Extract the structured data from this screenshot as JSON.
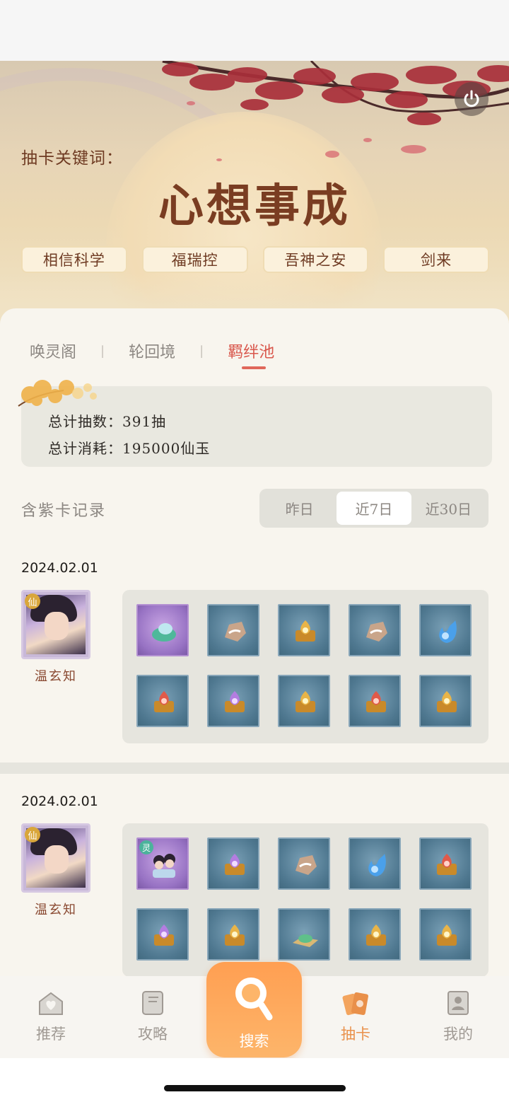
{
  "hero": {
    "keyword_label": "抽卡关键词：",
    "keyword_title": "心想事成",
    "tags": [
      "相信科学",
      "福瑞控",
      "吾神之安",
      "剑来"
    ]
  },
  "tabs": [
    {
      "label": "唤灵阁",
      "active": false
    },
    {
      "label": "轮回境",
      "active": false
    },
    {
      "label": "羁绊池",
      "active": true
    }
  ],
  "tab_separator": "|",
  "summary": {
    "total_draws": "总计抽数：391抽",
    "total_cost": "总计消耗：195000仙玉"
  },
  "records": {
    "label": "含紫卡记录",
    "filters": [
      {
        "label": "昨日",
        "active": false
      },
      {
        "label": "近7日",
        "active": true
      },
      {
        "label": "近30日",
        "active": false
      }
    ],
    "entries": [
      {
        "date": "2024.02.01",
        "character": {
          "name": "温玄知",
          "badge": "仙"
        },
        "items": [
          {
            "kind": "fairy-pet",
            "rarity": "purple",
            "icon": "jade-creature-icon",
            "color": "#4fb89a"
          },
          {
            "kind": "stone",
            "rarity": "blue",
            "icon": "stone-icon",
            "color": "#c9a58a"
          },
          {
            "kind": "gold-chest",
            "rarity": "blue",
            "icon": "gold-chest-icon",
            "color": "#e8b448"
          },
          {
            "kind": "stone",
            "rarity": "blue",
            "icon": "stone-icon",
            "color": "#c9a58a"
          },
          {
            "kind": "blue-flame",
            "rarity": "blue",
            "icon": "blue-flame-icon",
            "color": "#4aa0ea"
          },
          {
            "kind": "red-chest",
            "rarity": "blue",
            "icon": "red-chest-icon",
            "color": "#e05a4a"
          },
          {
            "kind": "purple-chest",
            "rarity": "blue",
            "icon": "purple-chest-icon",
            "color": "#b37de0"
          },
          {
            "kind": "gold-chest",
            "rarity": "blue",
            "icon": "gold-chest-icon",
            "color": "#e8b448"
          },
          {
            "kind": "red-chest",
            "rarity": "blue",
            "icon": "red-chest-icon",
            "color": "#e05a4a"
          },
          {
            "kind": "gold-chest",
            "rarity": "blue",
            "icon": "gold-chest-icon",
            "color": "#e8b448"
          }
        ]
      },
      {
        "date": "2024.02.01",
        "character": {
          "name": "温玄知",
          "badge": "仙"
        },
        "items": [
          {
            "kind": "spirit-card",
            "rarity": "purple",
            "icon": "spirit-card-icon",
            "color": "#6a5a8a",
            "badge": "灵"
          },
          {
            "kind": "purple-chest",
            "rarity": "blue",
            "icon": "purple-chest-icon",
            "color": "#b37de0"
          },
          {
            "kind": "stone",
            "rarity": "blue",
            "icon": "stone-icon",
            "color": "#c9a58a"
          },
          {
            "kind": "blue-flame",
            "rarity": "blue",
            "icon": "blue-flame-icon",
            "color": "#4aa0ea"
          },
          {
            "kind": "red-chest",
            "rarity": "blue",
            "icon": "red-chest-icon",
            "color": "#e05a4a"
          },
          {
            "kind": "purple-chest",
            "rarity": "blue",
            "icon": "purple-chest-icon",
            "color": "#b37de0"
          },
          {
            "kind": "gold-chest",
            "rarity": "blue",
            "icon": "gold-chest-icon",
            "color": "#e8b448"
          },
          {
            "kind": "jade-scroll",
            "rarity": "blue",
            "icon": "jade-scroll-icon",
            "color": "#5fc08a"
          },
          {
            "kind": "gold-chest",
            "rarity": "blue",
            "icon": "gold-chest-icon",
            "color": "#e8b448"
          },
          {
            "kind": "gold-chest",
            "rarity": "blue",
            "icon": "gold-chest-icon",
            "color": "#e8b448"
          }
        ]
      }
    ]
  },
  "nav": {
    "items": [
      {
        "label": "推荐",
        "icon": "heart-house-icon",
        "active": false
      },
      {
        "label": "攻略",
        "icon": "book-icon",
        "active": false
      },
      {
        "label": "搜索",
        "icon": "search-icon",
        "active": false
      },
      {
        "label": "抽卡",
        "icon": "cards-icon",
        "active": true
      },
      {
        "label": "我的",
        "icon": "profile-icon",
        "active": false
      }
    ]
  },
  "colors": {
    "accent": "#e0675a",
    "nav_active": "#e9904a",
    "fab": "#ff9f52"
  }
}
